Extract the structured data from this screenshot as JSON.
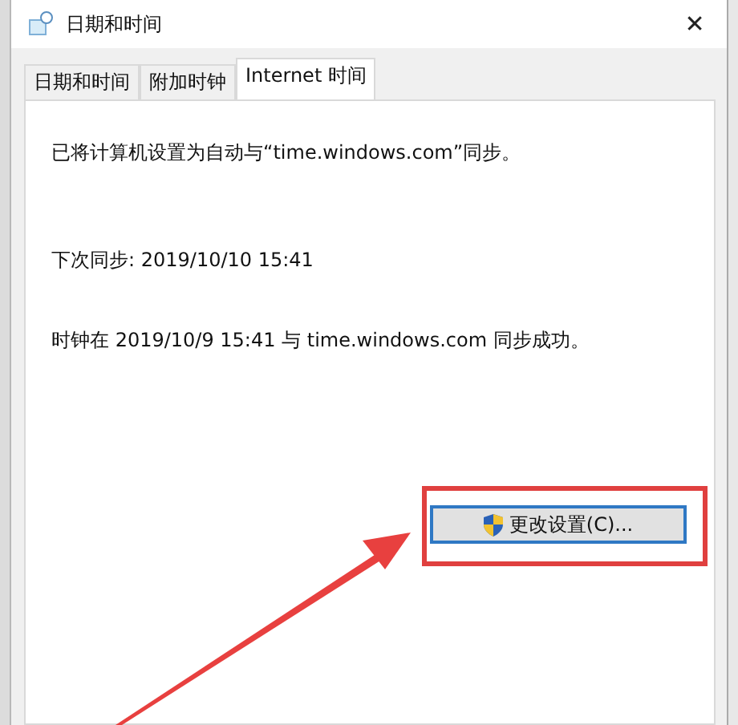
{
  "window": {
    "title": "日期和时间",
    "close": "✕"
  },
  "tabs": [
    {
      "label": "日期和时间",
      "selected": false
    },
    {
      "label": "附加时钟",
      "selected": false
    },
    {
      "label": "Internet 时间",
      "selected": true
    }
  ],
  "status_lines": [
    "已将计算机设置为自动与“time.windows.com”同步。",
    "下次同步: 2019/10/10 15:41",
    "时钟在 2019/10/9 15:41 与 time.windows.com 同步成功。"
  ],
  "button": {
    "label": "更改设置(C)..."
  }
}
